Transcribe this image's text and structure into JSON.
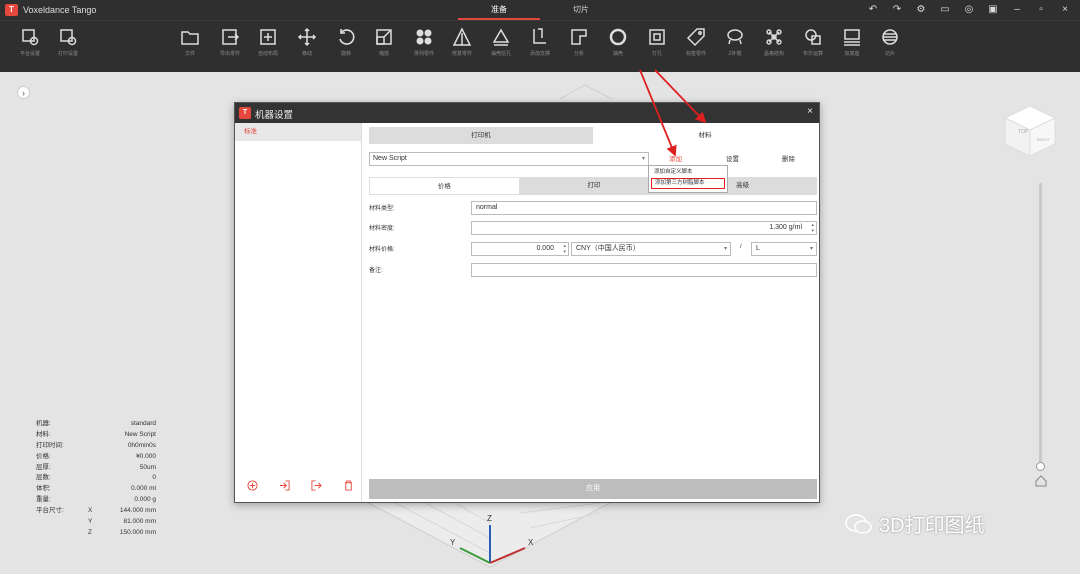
{
  "app": {
    "logo": "T",
    "title": "Voxeldance Tango"
  },
  "main_tabs": [
    {
      "label": "准备",
      "active": true
    },
    {
      "label": "切片",
      "active": false
    }
  ],
  "window_controls": [
    "undo-icon",
    "redo-icon",
    "gear-icon",
    "feedback-icon",
    "user-icon",
    "display-icon",
    "minimize-icon",
    "maximize-icon",
    "close-icon"
  ],
  "toolbar": {
    "left": [
      {
        "icon": "platform-settings-icon",
        "label": "平台设置"
      },
      {
        "icon": "print-settings-icon",
        "label": "打印设置"
      }
    ],
    "main": [
      {
        "icon": "folder-icon",
        "label": "文件"
      },
      {
        "icon": "import-icon",
        "label": "导出零件"
      },
      {
        "icon": "auto-layout-icon",
        "label": "自动布局"
      },
      {
        "icon": "move-icon",
        "label": "移动"
      },
      {
        "icon": "rotate-icon",
        "label": "旋转"
      },
      {
        "icon": "scale-icon",
        "label": "缩放"
      },
      {
        "icon": "nest-icon",
        "label": "排列零件"
      },
      {
        "icon": "repair-icon",
        "label": "修复零件"
      },
      {
        "icon": "hollow-icon",
        "label": "抽壳挖孔"
      },
      {
        "icon": "support-icon",
        "label": "添加支撑"
      },
      {
        "icon": "analysis-icon",
        "label": "分析"
      },
      {
        "icon": "ring-icon",
        "label": "抽壳"
      },
      {
        "icon": "crop-icon",
        "label": "打孔"
      },
      {
        "icon": "label-icon",
        "label": "标签零件"
      },
      {
        "icon": "cage-icon",
        "label": "Z补偿"
      },
      {
        "icon": "lattice-icon",
        "label": "晶格结构"
      },
      {
        "icon": "boolean-icon",
        "label": "布尔运算"
      },
      {
        "icon": "base-icon",
        "label": "加底座"
      },
      {
        "icon": "slice-icon",
        "label": "切片"
      }
    ]
  },
  "info_panel": [
    {
      "key": "机器:",
      "axis": "",
      "value": "standard"
    },
    {
      "key": "材料:",
      "axis": "",
      "value": "New Script"
    },
    {
      "key": "打印时间:",
      "axis": "",
      "value": "0h0min0s"
    },
    {
      "key": "价格:",
      "axis": "",
      "value": "¥0.000"
    },
    {
      "key": "层厚:",
      "axis": "",
      "value": "50um"
    },
    {
      "key": "层数:",
      "axis": "",
      "value": "0"
    },
    {
      "key": "体积:",
      "axis": "",
      "value": "0.000 ml"
    },
    {
      "key": "重量:",
      "axis": "",
      "value": "0.000 g"
    },
    {
      "key": "平台尺寸:",
      "axis": "X",
      "value": "144.000 mm"
    },
    {
      "key": "",
      "axis": "Y",
      "value": "81.000 mm"
    },
    {
      "key": "",
      "axis": "Z",
      "value": "150.000 mm"
    }
  ],
  "viewcube": {
    "face": "TOP",
    "side": "RIGHT"
  },
  "axes": {
    "x": "X",
    "y": "Y",
    "z": "Z"
  },
  "dialog": {
    "logo": "T",
    "title": "机器设置",
    "machines": [
      "标准"
    ],
    "top_tabs": [
      {
        "label": "打印机",
        "active": false
      },
      {
        "label": "材料",
        "active": true
      }
    ],
    "script_select": "New Script",
    "script_buttons": {
      "add": "添加",
      "settings": "设置",
      "delete": "删除"
    },
    "dropdown": [
      "添加自定义脚本",
      "添加第三方树脂脚本"
    ],
    "sub_tabs": [
      {
        "label": "价格",
        "active": true
      },
      {
        "label": "打印",
        "active": false
      },
      {
        "label": "高级",
        "active": false
      }
    ],
    "fields": {
      "material_type": {
        "label": "材料类型:",
        "value": "normal"
      },
      "density": {
        "label": "材料密度:",
        "value": "1.300 g/ml"
      },
      "price": {
        "label": "材料价格:",
        "value": "0.000",
        "currency": "CNY（中国人民币）",
        "sep": "/",
        "unit": "L"
      },
      "remark": {
        "label": "备注:",
        "value": ""
      }
    },
    "apply": "应用",
    "left_actions": [
      "add-machine-icon",
      "import-machine-icon",
      "export-machine-icon",
      "delete-machine-icon"
    ]
  },
  "watermark": "3D打印图纸",
  "colors": {
    "accent": "#e5473c",
    "toolbar": "#2f2f2f",
    "annotation": "#e02020"
  }
}
